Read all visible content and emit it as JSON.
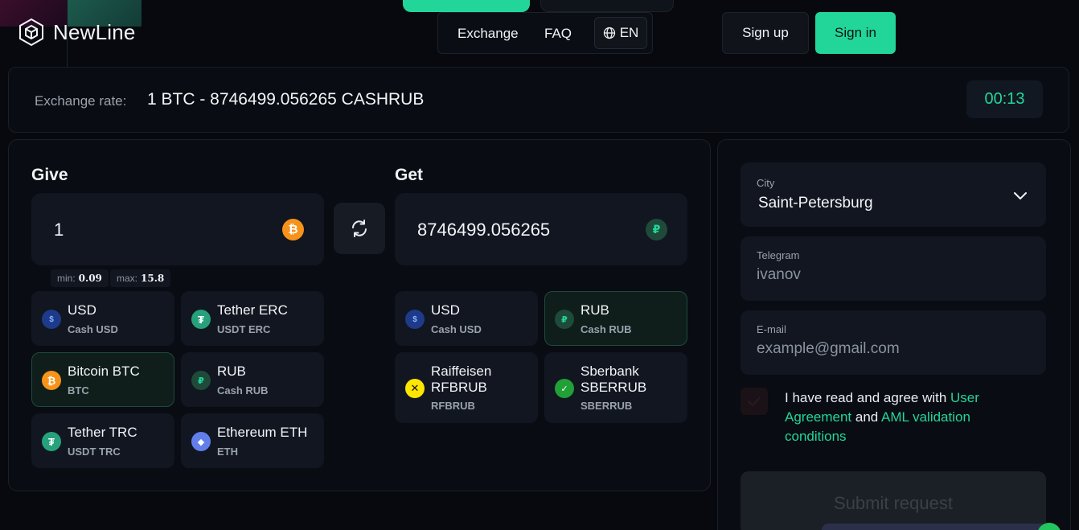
{
  "brand": {
    "name": "NewLine"
  },
  "nav": {
    "exchange": "Exchange",
    "faq": "FAQ",
    "lang": "EN"
  },
  "auth": {
    "signup": "Sign up",
    "signin": "Sign in"
  },
  "rate": {
    "label": "Exchange rate:",
    "value": "1 BTC - 8746499.056265 CASHRUB",
    "timer": "00:13"
  },
  "give": {
    "title": "Give",
    "amount": "1",
    "min_label": "min:",
    "min": "0.09",
    "max_label": "max:",
    "max": "15.8",
    "currencies": [
      {
        "name": "USD",
        "sub": "Cash USD",
        "icon": "dollar-icon",
        "glyph": "$",
        "color": "#1e3a8a"
      },
      {
        "name": "Tether ERC",
        "sub": "USDT ERC",
        "icon": "tether-icon",
        "glyph": "₮",
        "color": "#26a17b"
      },
      {
        "name": "Bitcoin BTC",
        "sub": "BTC",
        "icon": "bitcoin-icon",
        "glyph": "₿",
        "color": "#f7931a"
      },
      {
        "name": "RUB",
        "sub": "Cash RUB",
        "icon": "ruble-icon",
        "glyph": "₽",
        "color": "#1f4a3a"
      },
      {
        "name": "Tether TRC",
        "sub": "USDT TRC",
        "icon": "tether-icon",
        "glyph": "₮",
        "color": "#26a17b"
      },
      {
        "name": "Ethereum ETH",
        "sub": "ETH",
        "icon": "ethereum-icon",
        "glyph": "◆",
        "color": "#627eea"
      }
    ]
  },
  "get": {
    "title": "Get",
    "amount": "8746499.056265",
    "currencies": [
      {
        "name": "USD",
        "sub": "Cash USD",
        "icon": "dollar-icon",
        "glyph": "$",
        "color": "#1e3a8a"
      },
      {
        "name": "RUB",
        "sub": "Cash RUB",
        "icon": "ruble-icon",
        "glyph": "₽",
        "color": "#1f4a3a"
      },
      {
        "name": "Raiffeisen RFBRUB",
        "sub": "RFBRUB",
        "icon": "raiffeisen-icon",
        "glyph": "✕",
        "color": "#fee600"
      },
      {
        "name": "Sberbank SBERRUB",
        "sub": "SBERRUB",
        "icon": "sberbank-icon",
        "glyph": "✓",
        "color": "#21a038"
      }
    ]
  },
  "form": {
    "city_label": "City",
    "city_value": "Saint-Petersburg",
    "telegram_label": "Telegram",
    "telegram_placeholder": "ivanov",
    "email_label": "E-mail",
    "email_placeholder": "example@gmail.com",
    "agree_text1": "I have read and agree with ",
    "agree_link1": "User Agreement",
    "agree_text2": " and ",
    "agree_link2": "AML validation conditions",
    "submit": "Submit request"
  },
  "colors": {
    "accent": "#22d69a",
    "background": "#07090e",
    "panel": "#090c12",
    "card": "#111620"
  }
}
